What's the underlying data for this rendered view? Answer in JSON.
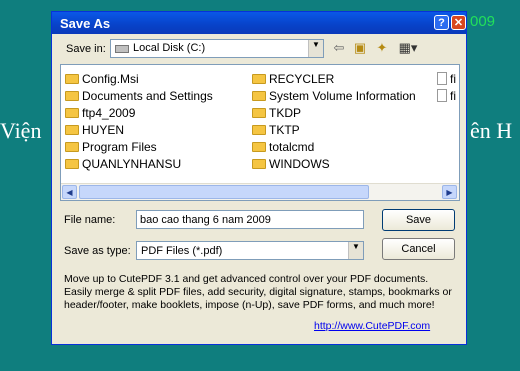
{
  "background": {
    "left_text": "Viện",
    "right_text": "ên H",
    "year_text": "009"
  },
  "dialog": {
    "title": "Save As",
    "help_glyph": "?",
    "close_glyph": "✕",
    "save_in_label": "Save in:",
    "save_in_value": "Local Disk (C:)",
    "file_name_label": "File name:",
    "file_name_value": "bao cao thang 6 nam 2009",
    "save_as_type_label": "Save as type:",
    "save_as_type_value": "PDF Files (*.pdf)",
    "save_button": "Save",
    "cancel_button": "Cancel",
    "promo_text": "Move up to CutePDF 3.1 and get advanced control over your PDF documents. Easily merge & split PDF files, add security, digital signature, stamps, bookmarks or header/footer, make booklets, impose (n-Up), save PDF forms, and much more!",
    "promo_link": "http://www.CutePDF.com"
  },
  "toolbar": {
    "back_icon": "back-arrow-icon",
    "up_icon": "up-folder-icon",
    "new_folder_icon": "new-folder-icon",
    "view_menu_icon": "view-menu-icon"
  },
  "files": {
    "col1": [
      "Config.Msi",
      "Documents and Settings",
      "ftp4_2009",
      "HUYEN",
      "Program Files",
      "QUANLYNHANSU"
    ],
    "col2": [
      "RECYCLER",
      "System Volume Information",
      "TKDP",
      "TKTP",
      "totalcmd",
      "WINDOWS"
    ],
    "col3": [
      "fi",
      "fi"
    ]
  },
  "colors": {
    "desktop": "#0f7e7e",
    "titlebar": "#0a58e8",
    "dialog": "#ece9d8",
    "link": "#0000ee"
  }
}
